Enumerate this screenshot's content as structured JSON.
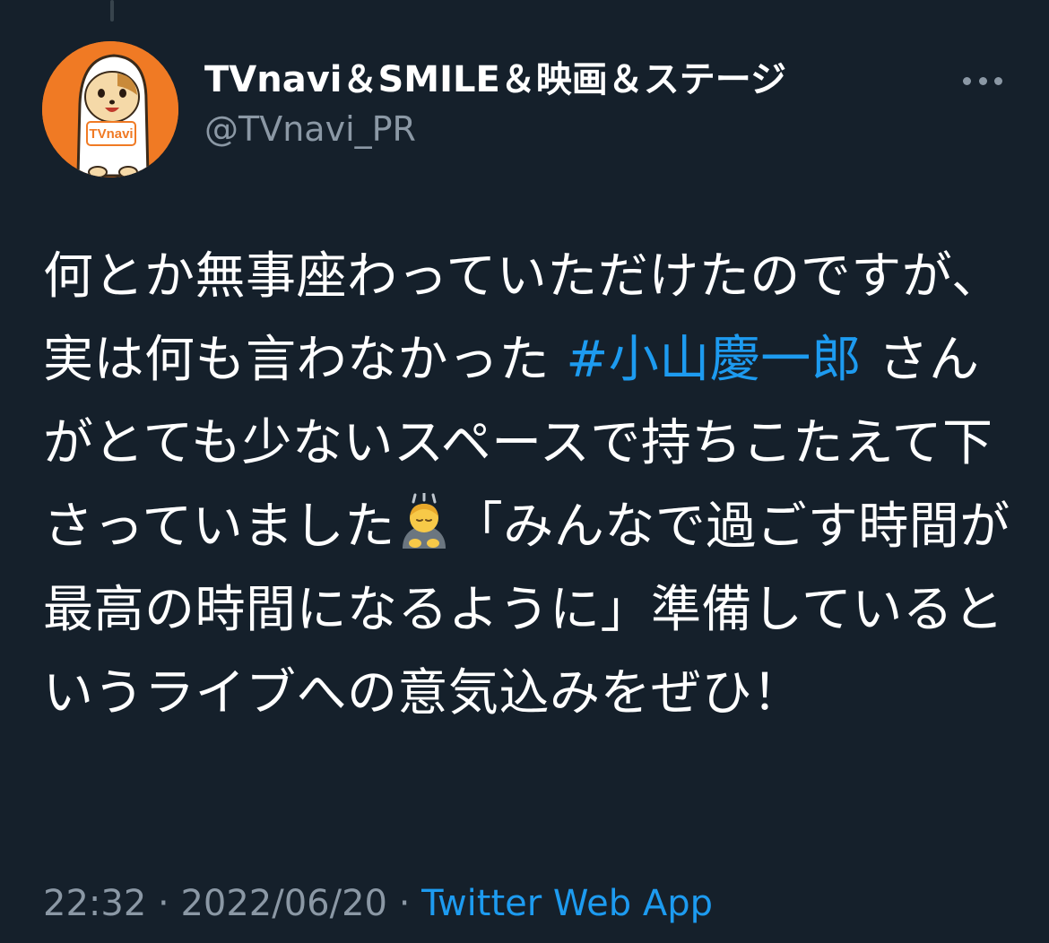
{
  "tweet": {
    "author": {
      "display_name": "TVnavi＆SMILE＆映画＆ステージ",
      "handle": "@TVnavi_PR",
      "avatar_badge": "TVnavi",
      "avatar_color": "#f07a24"
    },
    "text_parts": {
      "p1": "何とか無事座わっていただけたのですが、実は何も言わなかった ",
      "hashtag": "#小山慶一郎",
      "p2": " さんがとても少ないスペースで持ちこたえて下さっていました",
      "p3": "「みんなで過ごす時間が最高の時間になるように」準備しているというライブへの意気込みをぜひ！"
    },
    "emoji": "person-bowing-emoji",
    "time": "22:32",
    "separator": " · ",
    "date": "2022/06/20",
    "source": "Twitter Web App"
  },
  "icons": {
    "more": "more-dots-icon"
  },
  "colors": {
    "background": "#15202b",
    "link": "#1d9bf0",
    "secondary_text": "#8b98a5"
  }
}
